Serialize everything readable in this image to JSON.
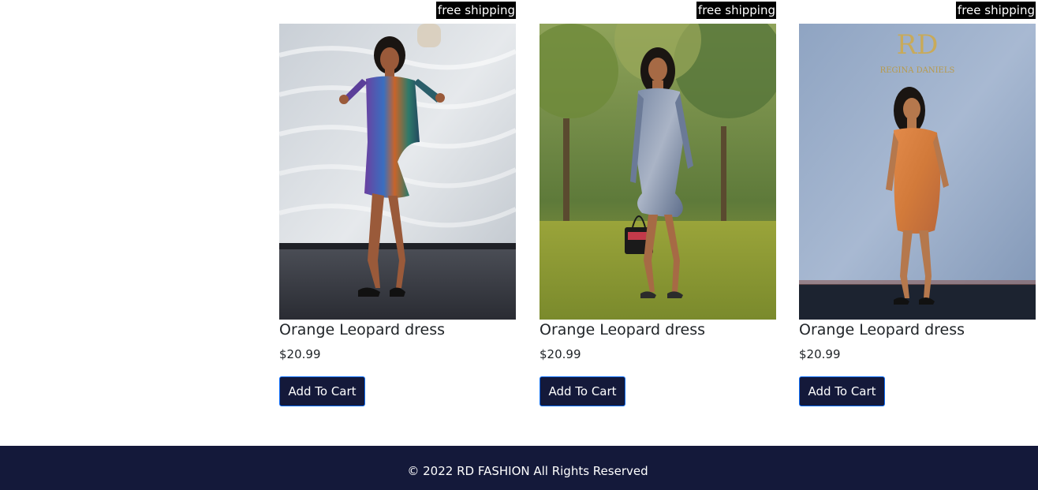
{
  "products": [
    {
      "badge": "free shipping",
      "title": "Orange Leopard dress",
      "price": "$20.99",
      "button_label": "Add To Cart",
      "image_alt": "Woman in multicolor sequin shirt dress"
    },
    {
      "badge": "free shipping",
      "title": "Orange Leopard dress",
      "price": "$20.99",
      "button_label": "Add To Cart",
      "image_alt": "Woman in printed ruffle dress outdoors"
    },
    {
      "badge": "free shipping",
      "title": "Orange Leopard dress",
      "price": "$20.99",
      "button_label": "Add To Cart",
      "image_alt": "Woman in orange leopard print dress"
    }
  ],
  "footer": {
    "copyright": "© 2022 RD FASHION All Rights Reserved"
  },
  "colors": {
    "navy": "#14193a",
    "badge_bg": "#000000",
    "button_border": "#0d6efd"
  }
}
